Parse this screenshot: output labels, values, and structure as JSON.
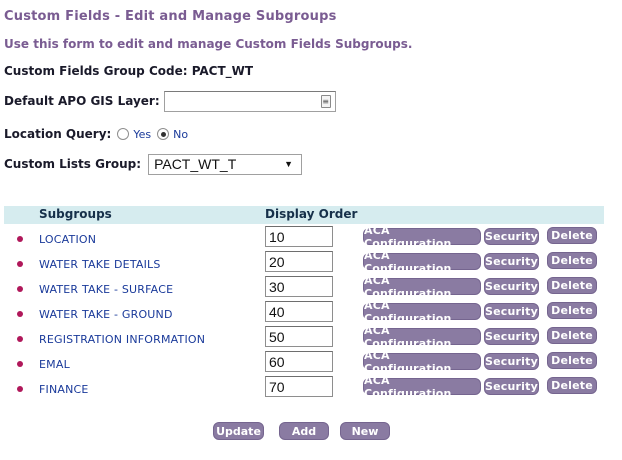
{
  "header": {
    "title": "Custom Fields - Edit and Manage Subgroups",
    "intro": "Use this form to edit and manage Custom Fields Subgroups.",
    "group_code": "Custom Fields Group Code: PACT_WT"
  },
  "form": {
    "gis_label": "Default APO GIS Layer:",
    "gis_value": "",
    "location_query_label": "Location Query:",
    "yes_label": "Yes",
    "no_label": "No",
    "location_query_selected": "No",
    "lists_label": "Custom Lists Group:",
    "lists_value": "PACT_WT_T"
  },
  "table": {
    "col_subgroups": "Subgroups",
    "col_display_order": "Display Order",
    "aca_label": "ACA Configuration",
    "security_label": "Security",
    "delete_label": "Delete",
    "rows": [
      {
        "name": "LOCATION",
        "order": "10"
      },
      {
        "name": "WATER TAKE DETAILS",
        "order": "20"
      },
      {
        "name": "WATER TAKE - SURFACE",
        "order": "30"
      },
      {
        "name": "WATER TAKE - GROUND",
        "order": "40"
      },
      {
        "name": "REGISTRATION INFORMATION",
        "order": "50"
      },
      {
        "name": "EMAL",
        "order": "60"
      },
      {
        "name": "FINANCE",
        "order": "70"
      }
    ]
  },
  "footer": {
    "update_label": "Update",
    "add_label": "Add",
    "new_label": "New"
  },
  "colors": {
    "accent": "#7a5c92",
    "button": "#8a7ba2",
    "header_band": "#d6ecef",
    "link": "#1a3a9a",
    "bullet": "#b0185a"
  },
  "icons": {
    "gis_picker": "text-input-picker-icon",
    "select": "chevron-down-icon",
    "bullet": "bullet-dot-icon"
  }
}
